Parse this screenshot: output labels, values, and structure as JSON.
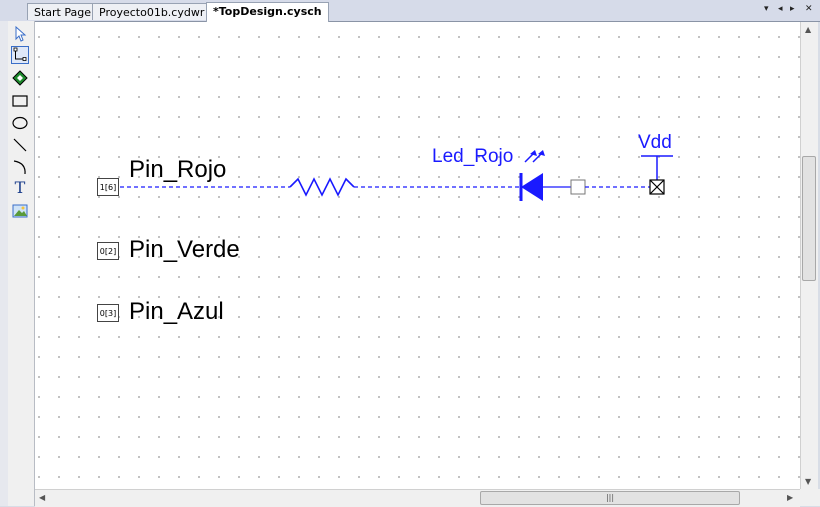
{
  "tabs": [
    {
      "label": "Start Page",
      "active": false
    },
    {
      "label": "Proyecto01b.cydwr",
      "active": false
    },
    {
      "label": "*TopDesign.cysch",
      "active": true
    }
  ],
  "tab_controls": {
    "menu": "▾",
    "prev": "◂",
    "next": "▸",
    "close": "✕"
  },
  "tools": [
    "pointer-icon",
    "wire-icon",
    "component-icon",
    "rectangle-icon",
    "ellipse-icon",
    "line-icon",
    "arc-icon",
    "text-icon",
    "image-icon"
  ],
  "tool_labels": {
    "text": "T"
  },
  "schematic": {
    "pins": [
      {
        "box": "1[6]",
        "label": "Pin_Rojo"
      },
      {
        "box": "0[2]",
        "label": "Pin_Verde"
      },
      {
        "box": "0[3]",
        "label": "Pin_Azul"
      }
    ],
    "led_label": "Led_Rojo",
    "power_label": "Vdd",
    "wire_color": "#1a1aff"
  },
  "scrollbars": {
    "grip": "|||"
  }
}
